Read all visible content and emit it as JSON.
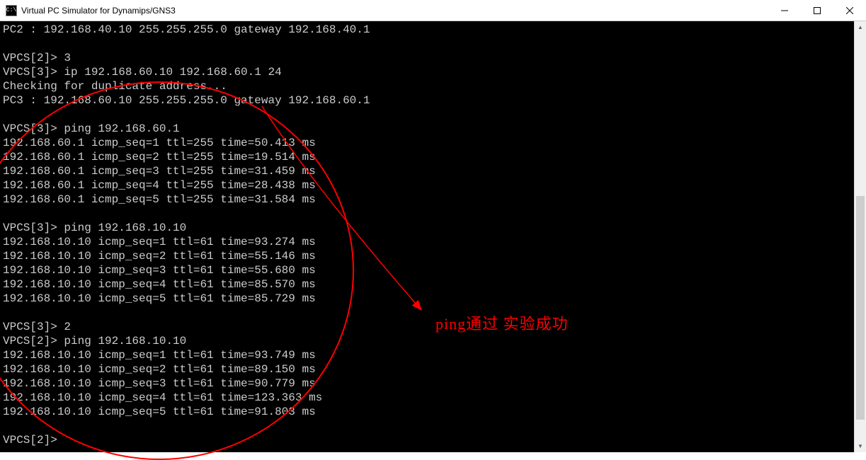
{
  "window": {
    "title": "Virtual PC Simulator for Dynamips/GNS3",
    "icon_label": "C:\\"
  },
  "terminal": {
    "lines": [
      "PC2 : 192.168.40.10 255.255.255.0 gateway 192.168.40.1",
      "",
      "VPCS[2]> 3",
      "VPCS[3]> ip 192.168.60.10 192.168.60.1 24",
      "Checking for duplicate address...",
      "PC3 : 192.168.60.10 255.255.255.0 gateway 192.168.60.1",
      "",
      "VPCS[3]> ping 192.168.60.1",
      "192.168.60.1 icmp_seq=1 ttl=255 time=50.413 ms",
      "192.168.60.1 icmp_seq=2 ttl=255 time=19.514 ms",
      "192.168.60.1 icmp_seq=3 ttl=255 time=31.459 ms",
      "192.168.60.1 icmp_seq=4 ttl=255 time=28.438 ms",
      "192.168.60.1 icmp_seq=5 ttl=255 time=31.584 ms",
      "",
      "VPCS[3]> ping 192.168.10.10",
      "192.168.10.10 icmp_seq=1 ttl=61 time=93.274 ms",
      "192.168.10.10 icmp_seq=2 ttl=61 time=55.146 ms",
      "192.168.10.10 icmp_seq=3 ttl=61 time=55.680 ms",
      "192.168.10.10 icmp_seq=4 ttl=61 time=85.570 ms",
      "192.168.10.10 icmp_seq=5 ttl=61 time=85.729 ms",
      "",
      "VPCS[3]> 2",
      "VPCS[2]> ping 192.168.10.10",
      "192.168.10.10 icmp_seq=1 ttl=61 time=93.749 ms",
      "192.168.10.10 icmp_seq=2 ttl=61 time=89.150 ms",
      "192.168.10.10 icmp_seq=3 ttl=61 time=90.779 ms",
      "192.168.10.10 icmp_seq=4 ttl=61 time=123.363 ms",
      "192.168.10.10 icmp_seq=5 ttl=61 time=91.803 ms",
      "",
      "VPCS[2]>"
    ]
  },
  "annotation": {
    "text": "ping通过  实验成功"
  }
}
